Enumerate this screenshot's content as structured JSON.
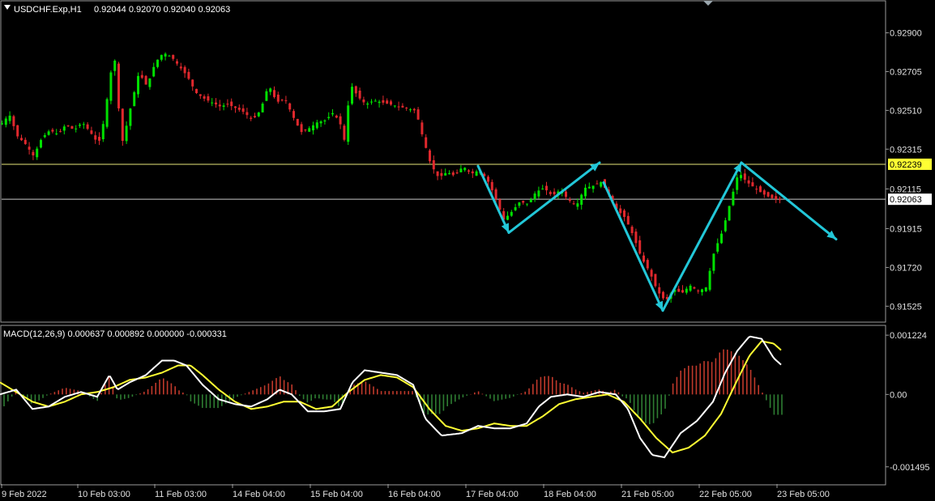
{
  "header": {
    "symbol": "USDCHF.Exp,H1",
    "ohlc": "0.92044 0.92070 0.92040 0.92063"
  },
  "macd_header": {
    "label": "MACD(12,26,9) 0.000637 0.000892 0.000000 -0.000331"
  },
  "colors": {
    "bull": "#00e000",
    "bear": "#e0282d",
    "hist_pos": "#c0392b",
    "hist_neg": "#2e7d32",
    "macd_line": "#ffffff",
    "signal_line": "#ffff33",
    "arrow": "#22c7d8",
    "level_high": "#e8e87a",
    "level_current": "#c8c8c8",
    "badge_high_bg": "#ffff33"
  },
  "chart_data": [
    {
      "type": "candlestick",
      "title": "USDCHF.Exp,H1",
      "y_ticks": [
        "0.92900",
        "0.92705",
        "0.92510",
        "0.92315",
        "0.92115",
        "0.91915",
        "0.91720",
        "0.91525"
      ],
      "x_ticks": [
        "9 Feb 2022",
        "10 Feb 03:00",
        "11 Feb 03:00",
        "14 Feb 04:00",
        "15 Feb 04:00",
        "16 Feb 04:00",
        "17 Feb 04:00",
        "18 Feb 04:00",
        "21 Feb 05:00",
        "22 Feb 05:00",
        "23 Feb 05:00"
      ],
      "ylim": [
        0.91449,
        0.93057
      ],
      "levels": [
        {
          "name": "high-level",
          "value": 0.92239,
          "label": "0.92239"
        },
        {
          "name": "current-price",
          "value": 0.92063,
          "label": "0.92063"
        }
      ],
      "close_path": [
        [
          0,
          0.9244
        ],
        [
          10,
          0.9249
        ],
        [
          20,
          0.9238
        ],
        [
          30,
          0.9234
        ],
        [
          40,
          0.9228
        ],
        [
          50,
          0.9237
        ],
        [
          60,
          0.9241
        ],
        [
          70,
          0.9239
        ],
        [
          80,
          0.9244
        ],
        [
          90,
          0.9241
        ],
        [
          100,
          0.9245
        ],
        [
          110,
          0.924
        ],
        [
          120,
          0.9234
        ],
        [
          128,
          0.9248
        ],
        [
          134,
          0.9268
        ],
        [
          140,
          0.9277
        ],
        [
          145,
          0.9252
        ],
        [
          150,
          0.9235
        ],
        [
          160,
          0.9253
        ],
        [
          170,
          0.927
        ],
        [
          180,
          0.9263
        ],
        [
          190,
          0.9275
        ],
        [
          200,
          0.928
        ],
        [
          210,
          0.9278
        ],
        [
          220,
          0.9273
        ],
        [
          230,
          0.9268
        ],
        [
          240,
          0.926
        ],
        [
          250,
          0.9257
        ],
        [
          260,
          0.9255
        ],
        [
          270,
          0.9253
        ],
        [
          280,
          0.9254
        ],
        [
          290,
          0.9252
        ],
        [
          300,
          0.925
        ],
        [
          310,
          0.9246
        ],
        [
          320,
          0.9251
        ],
        [
          330,
          0.9264
        ],
        [
          340,
          0.9255
        ],
        [
          350,
          0.9257
        ],
        [
          360,
          0.9248
        ],
        [
          370,
          0.924
        ],
        [
          380,
          0.9242
        ],
        [
          390,
          0.9245
        ],
        [
          400,
          0.9246
        ],
        [
          410,
          0.925
        ],
        [
          420,
          0.9243
        ],
        [
          425,
          0.9233
        ],
        [
          430,
          0.9265
        ],
        [
          440,
          0.9258
        ],
        [
          450,
          0.9254
        ],
        [
          460,
          0.9256
        ],
        [
          470,
          0.9255
        ],
        [
          480,
          0.9254
        ],
        [
          490,
          0.9253
        ],
        [
          500,
          0.9252
        ],
        [
          510,
          0.9251
        ],
        [
          515,
          0.9246
        ],
        [
          520,
          0.9238
        ],
        [
          530,
          0.9224
        ],
        [
          540,
          0.9217
        ],
        [
          550,
          0.922
        ],
        [
          560,
          0.9218
        ],
        [
          570,
          0.9223
        ],
        [
          580,
          0.9219
        ],
        [
          590,
          0.9221
        ],
        [
          600,
          0.9216
        ],
        [
          610,
          0.9207
        ],
        [
          620,
          0.9196
        ],
        [
          630,
          0.92
        ],
        [
          640,
          0.9205
        ],
        [
          650,
          0.9204
        ],
        [
          660,
          0.921
        ],
        [
          670,
          0.9212
        ],
        [
          680,
          0.9208
        ],
        [
          690,
          0.9211
        ],
        [
          700,
          0.9206
        ],
        [
          710,
          0.9203
        ],
        [
          720,
          0.9212
        ],
        [
          730,
          0.9213
        ],
        [
          740,
          0.9215
        ],
        [
          750,
          0.9209
        ],
        [
          760,
          0.9201
        ],
        [
          770,
          0.9197
        ],
        [
          780,
          0.9188
        ],
        [
          790,
          0.9177
        ],
        [
          800,
          0.917
        ],
        [
          810,
          0.916
        ],
        [
          820,
          0.9155
        ],
        [
          830,
          0.9161
        ],
        [
          840,
          0.9159
        ],
        [
          850,
          0.9163
        ],
        [
          860,
          0.916
        ],
        [
          870,
          0.9162
        ],
        [
          880,
          0.918
        ],
        [
          890,
          0.919
        ],
        [
          900,
          0.9205
        ],
        [
          910,
          0.922
        ],
        [
          920,
          0.9215
        ],
        [
          930,
          0.9212
        ],
        [
          940,
          0.9209
        ],
        [
          950,
          0.9207
        ],
        [
          960,
          0.9206
        ]
      ],
      "arrows": [
        {
          "from": [
            590,
            0.9223
          ],
          "to": [
            628,
            0.91895
          ]
        },
        {
          "from": [
            628,
            0.91895
          ],
          "to": [
            740,
            0.92247
          ]
        },
        {
          "from": [
            745,
            0.92147
          ],
          "to": [
            818,
            0.91503
          ]
        },
        {
          "from": [
            818,
            0.91503
          ],
          "to": [
            915,
            0.92247
          ]
        },
        {
          "from": [
            915,
            0.92247
          ],
          "to": [
            1032,
            0.91862
          ]
        }
      ]
    },
    {
      "type": "line",
      "title": "MACD(12,26,9) 0.000637 0.000892 0.000000 -0.000331",
      "y_ticks": [
        "0.001224",
        "0.00",
        "-0.001495"
      ],
      "ylim": [
        -0.00185,
        0.00141
      ],
      "series": [
        {
          "role": "macd",
          "points": [
            [
              0,
              0.0
            ],
            [
              20,
              0.0001
            ],
            [
              40,
              -0.0003
            ],
            [
              60,
              -0.00025
            ],
            [
              80,
              -5e-05
            ],
            [
              100,
              5e-05
            ],
            [
              120,
              -5e-05
            ],
            [
              135,
              0.0004
            ],
            [
              145,
              0.0001
            ],
            [
              160,
              0.00025
            ],
            [
              180,
              0.0004
            ],
            [
              200,
              0.0007
            ],
            [
              215,
              0.0007
            ],
            [
              230,
              0.0006
            ],
            [
              250,
              0.0002
            ],
            [
              270,
              -0.0001
            ],
            [
              290,
              -0.0002
            ],
            [
              310,
              -0.00025
            ],
            [
              330,
              -0.0001
            ],
            [
              345,
              0.0001
            ],
            [
              360,
              0.0
            ],
            [
              380,
              -0.00035
            ],
            [
              400,
              -0.00035
            ],
            [
              420,
              -0.0003
            ],
            [
              435,
              0.00025
            ],
            [
              450,
              0.0005
            ],
            [
              470,
              0.00045
            ],
            [
              490,
              0.0004
            ],
            [
              510,
              0.0002
            ],
            [
              525,
              -0.0005
            ],
            [
              545,
              -0.00085
            ],
            [
              570,
              -0.0008
            ],
            [
              590,
              -0.00065
            ],
            [
              610,
              -0.0007
            ],
            [
              630,
              -0.0007
            ],
            [
              650,
              -0.0006
            ],
            [
              665,
              -0.00025
            ],
            [
              680,
              -5e-05
            ],
            [
              700,
              0.0
            ],
            [
              720,
              -5e-05
            ],
            [
              740,
              5e-05
            ],
            [
              760,
              0.0
            ],
            [
              775,
              -0.0003
            ],
            [
              790,
              -0.0009
            ],
            [
              805,
              -0.00125
            ],
            [
              820,
              -0.0013
            ],
            [
              840,
              -0.0008
            ],
            [
              860,
              -0.00055
            ],
            [
              880,
              -0.00015
            ],
            [
              895,
              0.00045
            ],
            [
              910,
              0.0009
            ],
            [
              925,
              0.0012
            ],
            [
              940,
              0.00115
            ],
            [
              955,
              0.00075
            ],
            [
              965,
              0.0006
            ]
          ]
        },
        {
          "role": "signal",
          "points": [
            [
              0,
              0.00025
            ],
            [
              20,
              5e-05
            ],
            [
              40,
              -0.00015
            ],
            [
              60,
              -0.00025
            ],
            [
              80,
              -0.00015
            ],
            [
              100,
              0.0
            ],
            [
              120,
              5e-05
            ],
            [
              140,
              0.00015
            ],
            [
              160,
              0.0003
            ],
            [
              180,
              0.00035
            ],
            [
              200,
              0.00045
            ],
            [
              220,
              0.0006
            ],
            [
              235,
              0.0006
            ],
            [
              250,
              0.0004
            ],
            [
              270,
              0.0001
            ],
            [
              290,
              -0.00015
            ],
            [
              310,
              -0.0003
            ],
            [
              330,
              -0.00025
            ],
            [
              350,
              -0.00015
            ],
            [
              370,
              -0.00015
            ],
            [
              390,
              -0.0003
            ],
            [
              410,
              -0.00025
            ],
            [
              430,
              5e-05
            ],
            [
              450,
              0.0003
            ],
            [
              470,
              0.0004
            ],
            [
              490,
              0.00035
            ],
            [
              510,
              0.00015
            ],
            [
              530,
              -0.0003
            ],
            [
              550,
              -0.00065
            ],
            [
              570,
              -0.00075
            ],
            [
              590,
              -0.0007
            ],
            [
              610,
              -0.0006
            ],
            [
              630,
              -0.00065
            ],
            [
              650,
              -0.00065
            ],
            [
              670,
              -0.00045
            ],
            [
              690,
              -0.0002
            ],
            [
              710,
              -0.0001
            ],
            [
              730,
              -5e-05
            ],
            [
              750,
              0.0
            ],
            [
              770,
              -0.00015
            ],
            [
              790,
              -0.0005
            ],
            [
              810,
              -0.0009
            ],
            [
              830,
              -0.0012
            ],
            [
              850,
              -0.0011
            ],
            [
              870,
              -0.00085
            ],
            [
              890,
              -0.0004
            ],
            [
              910,
              0.0003
            ],
            [
              925,
              0.0008
            ],
            [
              940,
              0.0011
            ],
            [
              955,
              0.00105
            ],
            [
              965,
              0.0009
            ]
          ]
        }
      ],
      "histogram_range": [
        5,
        965
      ]
    }
  ]
}
